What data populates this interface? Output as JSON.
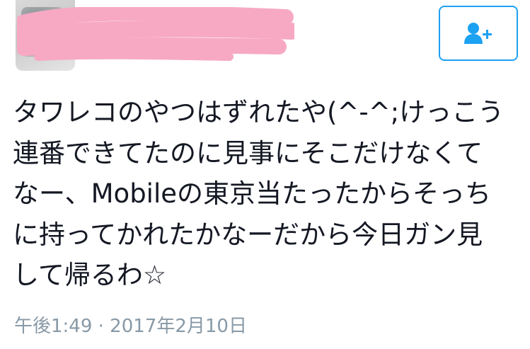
{
  "header": {
    "follow_button": {
      "icon": "add-user-icon",
      "color": "#1da1f2"
    },
    "redaction_color": "#f7a9c4"
  },
  "tweet": {
    "lines": [
      "タワレコのやつはずれたや(^-^;けっこう",
      "連番できてたのに見事にそこだけなくて",
      "なー、Mobileの東京当たったからそっち",
      "に持ってかれたかなーだから今日ガン見",
      "して帰るわ☆"
    ],
    "timestamp": "午後1:49 · 2017年2月10日"
  }
}
